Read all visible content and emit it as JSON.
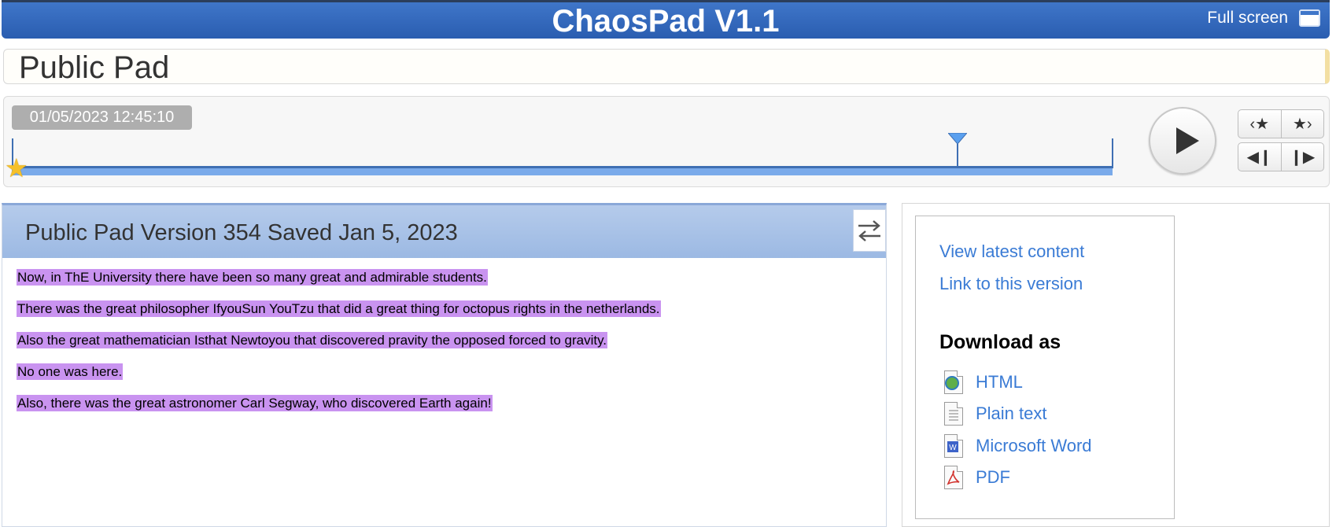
{
  "app": {
    "title": "ChaosPad V1.1",
    "fullscreen_label": "Full screen"
  },
  "pad": {
    "name": "Public Pad"
  },
  "timeslider": {
    "timestamp": "01/05/2023 12:45:10"
  },
  "revision": {
    "header": "Public Pad Version 354 Saved Jan 5, 2023",
    "paragraphs": [
      "Now, in ThE University there have been so many great and admirable students.",
      "There was the great philosopher IfyouSun YouTzu that did a great thing for octopus rights in the netherlands.",
      "Also the great mathematician Isthat Newtoyou that discovered pravity the opposed forced to gravity.",
      "No one was here. ",
      "Also, there was the great astronomer Carl Segway, who discovered Earth again!"
    ],
    "highlight_color": "#c993f0"
  },
  "sidebar": {
    "view_latest": "View latest content",
    "link_version": "Link to this version",
    "download_heading": "Download as",
    "downloads": [
      {
        "label": "HTML",
        "icon": "html-file-icon"
      },
      {
        "label": "Plain text",
        "icon": "text-file-icon"
      },
      {
        "label": "Microsoft Word",
        "icon": "word-file-icon"
      },
      {
        "label": "PDF",
        "icon": "pdf-file-icon"
      }
    ]
  },
  "colors": {
    "header_blue": "#2f64b6",
    "link": "#3a7bd5"
  }
}
